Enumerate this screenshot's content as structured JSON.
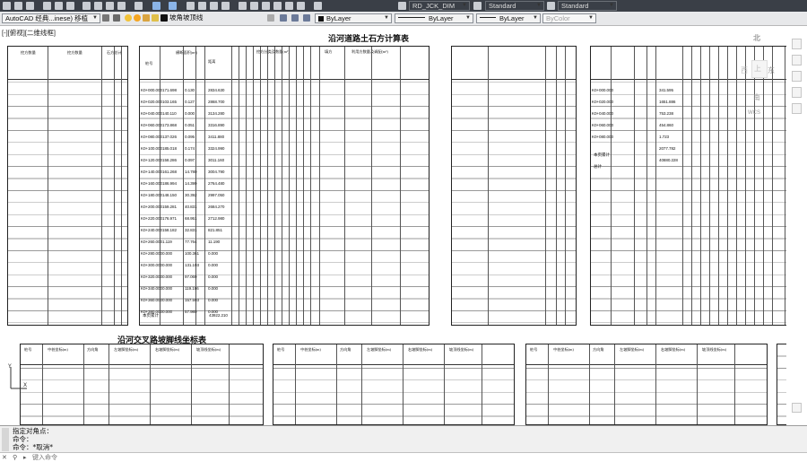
{
  "toolbar": {
    "workspace": "AutoCAD 经典...inese) 移植",
    "layer_name": "坡角坡顶线",
    "dim_style": "RD_JCK_DIM",
    "text_style": "Standard",
    "table_style": "Standard",
    "color": "ByLayer",
    "linetype": "ByLayer",
    "lineweight": "ByLayer",
    "plotstyle": "ByColor"
  },
  "viewport_label": "[-][俯视][二维线框]",
  "drawing": {
    "title_main": "沿河道路土石方计算表",
    "title_coord": "沿河交叉路坡脚线坐标表",
    "total_label": "本页累计",
    "left_table_top_hdr": [
      "挖方数量",
      "挖方数量",
      "石方总计"
    ],
    "main_table_hdr": [
      "桩号",
      "横断面积(m²)",
      "距离",
      "挖方分类及数量(m³)",
      "填方",
      "利用方数量及调配(m³)"
    ],
    "stations": [
      "K0+000.000",
      "K0+020.000",
      "K0+040.000",
      "K0+060.000",
      "K0+080.000",
      "K0+100.000",
      "K0+120.000",
      "K0+140.000",
      "K0+160.000",
      "K0+180.000",
      "K0+200.000",
      "K0+220.000",
      "K0+240.000",
      "K0+260.000",
      "K0+280.000",
      "K0+300.000",
      "K0+320.000",
      "K0+340.000",
      "K0+360.000",
      "K0+380.000"
    ],
    "areas_cut": [
      "171.698",
      "103.165",
      "140.110",
      "173.868",
      "137.026",
      "185.018",
      "158.286",
      "161.268",
      "186.994",
      "148.150",
      "159.281",
      "176.971",
      "158.182",
      "1.119",
      "0.000",
      "0.000",
      "0.000",
      "0.000",
      "0.000",
      "0.000"
    ],
    "areas_fill": [
      "0.130",
      "0.127",
      "0.000",
      "0.051",
      "0.095",
      "0.174",
      "0.097",
      "14.780",
      "14.399",
      "30.392",
      "40.831",
      "68.951",
      "32.831",
      "77.764",
      "100.361",
      "131.193",
      "97.069",
      "119.196",
      "157.593",
      "57.980"
    ],
    "distance": [
      "20.000",
      "20.000",
      "20.000",
      "20.000",
      "20.000",
      "20.000",
      "20.000",
      "20.000",
      "20.000",
      "20.000",
      "20.000",
      "20.000",
      "20.000",
      "20.000",
      "20.000",
      "20.000",
      "20.000",
      "20.000",
      "20.000",
      "20.000"
    ],
    "cut_volume": [
      "2834.630",
      "2868.700",
      "3134.280",
      "3316.890",
      "3411.880",
      "3324.990",
      "3011.160",
      "3004.790",
      "2764.480",
      "2997.050",
      "2684.270",
      "2712.980",
      "821.851",
      "11.190",
      "0.000",
      "0.000",
      "0.000",
      "0.000",
      "0.000",
      "0.000"
    ],
    "total_cut": "43922.210",
    "right_table_values": [
      "341.595",
      "1651.886",
      "753.238",
      "454.860",
      "1.723",
      "2077.782",
      "40880.228"
    ],
    "right_table_stations": [
      "K0+000.000",
      "K0+020.000",
      "K0+040.000",
      "K0+060.000",
      "K0+080.000"
    ],
    "right_table_labels": [
      "本页累计",
      "总计"
    ],
    "coord_hdr": [
      "桩号",
      "中桩坐标(m)",
      "方向角",
      "左坡脚坐标(m)",
      "右坡脚坐标(m)",
      "坡顶线坐标(m)"
    ],
    "coord_rows": 9
  },
  "navcube": {
    "north": "北",
    "east": "东",
    "south": "南",
    "wcs": "WCS"
  },
  "command": {
    "history": [
      "指定对角点：",
      "命令：",
      "命令：*取消*"
    ],
    "placeholder": "键入命令"
  }
}
